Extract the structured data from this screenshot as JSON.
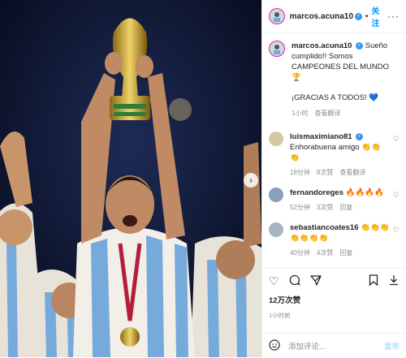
{
  "header": {
    "username": "marcos.acuna10",
    "follow_label": "关注",
    "more_label": "···"
  },
  "caption": {
    "username": "marcos.acuna10",
    "text": "Sueño cumplido!! Somos CAMPEONES DEL MUNDO 🏆",
    "text2": "¡GRACIAS A TODOS! 💙",
    "time": "1小时",
    "translate": "查看翻译"
  },
  "comments": [
    {
      "username": "luismaximiano81",
      "text": "Enhorabuena amigo 👏👏👏",
      "time": "18分钟",
      "likes": "8次赞",
      "action": "查看翻译",
      "avatar": "#d9c7a3"
    },
    {
      "username": "fernandoreges",
      "text": "🔥🔥🔥🔥",
      "time": "52分钟",
      "likes": "3次赞",
      "action": "回复",
      "avatar": "#8a9fb8"
    },
    {
      "username": "sebastiancoates16",
      "text": "👏👏👏👏👏👏👏",
      "time": "40分钟",
      "likes": "4次赞",
      "action": "回复",
      "avatar": "#a8b4c4"
    }
  ],
  "actions": {
    "like_icon": "heart-icon",
    "comment_icon": "comment-icon",
    "share_icon": "send-icon",
    "save_icon": "bookmark-icon",
    "download_icon": "download-icon"
  },
  "likes_text": "12万次赞",
  "posted_ago": "1小时前",
  "add_comment": {
    "placeholder": "添加评论...",
    "post_label": "发布"
  },
  "colors": {
    "accent": "#0095f6",
    "verified": "#3897f0",
    "jersey_blue": "#75aadb"
  }
}
